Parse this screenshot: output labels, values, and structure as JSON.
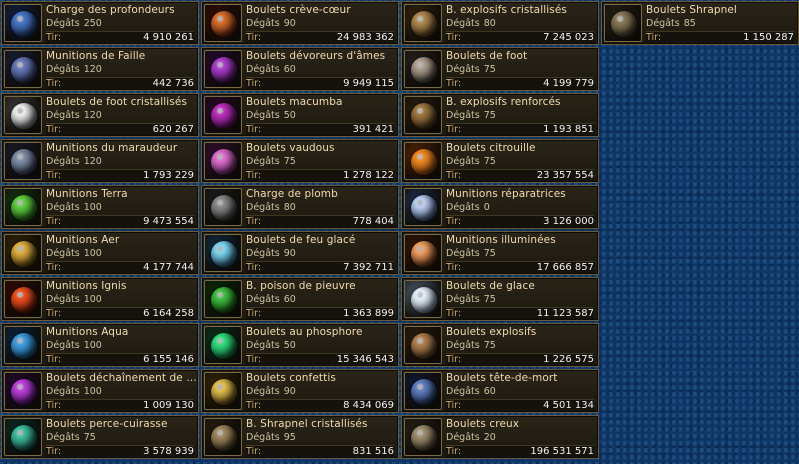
{
  "labels": {
    "damage": "Dégâts",
    "range": "Tir:"
  },
  "items": [
    {
      "name": "Charge des profondeurs",
      "damage": "250",
      "range": "4 910 261",
      "icon": "deep-charge-icon",
      "c1": "#4a78c8",
      "c2": "#13244a"
    },
    {
      "name": "Boulets crève-cœur",
      "damage": "90",
      "range": "24 983 362",
      "icon": "heartbreaker-icon",
      "c1": "#d8702a",
      "c2": "#3a0e08"
    },
    {
      "name": "B. explosifs cristallisés",
      "damage": "80",
      "range": "7 245 023",
      "icon": "crystal-explosive-icon",
      "c1": "#b08a50",
      "c2": "#3a2812"
    },
    {
      "name": "Boulets Shrapnel",
      "damage": "85",
      "range": "1 150 287",
      "icon": "shrapnel-icon",
      "c1": "#8a7a5a",
      "c2": "#2a2418"
    },
    {
      "name": "Munitions de Faille",
      "damage": "120",
      "range": "442 736",
      "icon": "rift-ammo-icon",
      "c1": "#6a7ab8",
      "c2": "#1c2040"
    },
    {
      "name": "Boulets dévoreurs d'âmes",
      "damage": "60",
      "range": "9 949 115",
      "icon": "soul-devourer-icon",
      "c1": "#b040d0",
      "c2": "#2a0a38"
    },
    {
      "name": "Boulets de foot",
      "damage": "75",
      "range": "4 199 779",
      "icon": "football-icon",
      "c1": "#b0a090",
      "c2": "#2a2420"
    },
    {
      "name": "Boulets de foot cristallisés",
      "damage": "120",
      "range": "620 267",
      "icon": "crystal-football-icon",
      "c1": "#f0f0f0",
      "c2": "#404040"
    },
    {
      "name": "Boulets macumba",
      "damage": "50",
      "range": "391 421",
      "icon": "macumba-icon",
      "c1": "#c030c0",
      "c2": "#300830"
    },
    {
      "name": "B. explosifs renforcés",
      "damage": "75",
      "range": "1 193 851",
      "icon": "reinforced-explosive-icon",
      "c1": "#a07840",
      "c2": "#2e2010"
    },
    {
      "name": "Munitions du maraudeur",
      "damage": "120",
      "range": "1 793 229",
      "icon": "marauder-icon",
      "c1": "#8090a8",
      "c2": "#1c2030"
    },
    {
      "name": "Boulets vaudous",
      "damage": "75",
      "range": "1 278 122",
      "icon": "voodoo-icon",
      "c1": "#e070d0",
      "c2": "#3a1038"
    },
    {
      "name": "Boulets citrouille",
      "damage": "75",
      "range": "23 357 554",
      "icon": "pumpkin-icon",
      "c1": "#f08a20",
      "c2": "#5a2808"
    },
    {
      "name": "Munitions Terra",
      "damage": "100",
      "range": "9 473 554",
      "icon": "terra-icon",
      "c1": "#60d040",
      "c2": "#143a10"
    },
    {
      "name": "Charge de plomb",
      "damage": "80",
      "range": "778 404",
      "icon": "lead-charge-icon",
      "c1": "#8a8a8a",
      "c2": "#202020"
    },
    {
      "name": "Munitions réparatrices",
      "damage": "0",
      "range": "3 126 000",
      "icon": "repair-ammo-icon",
      "c1": "#c0d0f0",
      "c2": "#203050"
    },
    {
      "name": "Munitions Aer",
      "damage": "100",
      "range": "4 177 744",
      "icon": "aer-icon",
      "c1": "#e0b040",
      "c2": "#3a2808"
    },
    {
      "name": "Boulets de feu glacé",
      "damage": "90",
      "range": "7 392 711",
      "icon": "ice-fire-icon",
      "c1": "#80d8f0",
      "c2": "#103048"
    },
    {
      "name": "Munitions illuminées",
      "damage": "75",
      "range": "17 666 857",
      "icon": "illuminated-icon",
      "c1": "#f0a060",
      "c2": "#3a1808"
    },
    {
      "name": "Munitions Ignis",
      "damage": "100",
      "range": "6 164 258",
      "icon": "ignis-icon",
      "c1": "#f05020",
      "c2": "#3a0c04"
    },
    {
      "name": "B. poison de pieuvre",
      "damage": "60",
      "range": "1 363 899",
      "icon": "octopus-poison-icon",
      "c1": "#40c040",
      "c2": "#0a300a"
    },
    {
      "name": "Boulets de glace",
      "damage": "75",
      "range": "11 123 587",
      "icon": "ice-ball-icon",
      "c1": "#e8f0f8",
      "c2": "#506070"
    },
    {
      "name": "Munitions Aqua",
      "damage": "100",
      "range": "6 155 146",
      "icon": "aqua-icon",
      "c1": "#40a0e0",
      "c2": "#0a2a48"
    },
    {
      "name": "Boulets au phosphore",
      "damage": "50",
      "range": "15 346 543",
      "icon": "phosphor-icon",
      "c1": "#30e080",
      "c2": "#083a20"
    },
    {
      "name": "Boulets explosifs",
      "damage": "75",
      "range": "1 226 575",
      "icon": "explosive-icon",
      "c1": "#b08050",
      "c2": "#302010"
    },
    {
      "name": "Boulets déchaînement de l'enfer",
      "damage": "100",
      "range": "1 009 130",
      "icon": "hell-unleashed-icon",
      "c1": "#c040e0",
      "c2": "#280838"
    },
    {
      "name": "Boulets confettis",
      "damage": "90",
      "range": "8 434 069",
      "icon": "confetti-icon",
      "c1": "#e0c050",
      "c2": "#3a2a08"
    },
    {
      "name": "Boulets tête-de-mort",
      "damage": "60",
      "range": "4 501 134",
      "icon": "skull-icon",
      "c1": "#6080c0",
      "c2": "#101c38"
    },
    {
      "name": "Boulets perce-cuirasse",
      "damage": "75",
      "range": "3 578 939",
      "icon": "armor-piercing-icon",
      "c1": "#40c0a0",
      "c2": "#0a3028"
    },
    {
      "name": "B. Shrapnel cristallisés",
      "damage": "95",
      "range": "831 516",
      "icon": "crystal-shrapnel-icon",
      "c1": "#a08a60",
      "c2": "#2a2010"
    },
    {
      "name": "Boulets creux",
      "damage": "20",
      "range": "196 531 571",
      "icon": "hollow-icon",
      "c1": "#a09070",
      "c2": "#2a2418"
    }
  ]
}
